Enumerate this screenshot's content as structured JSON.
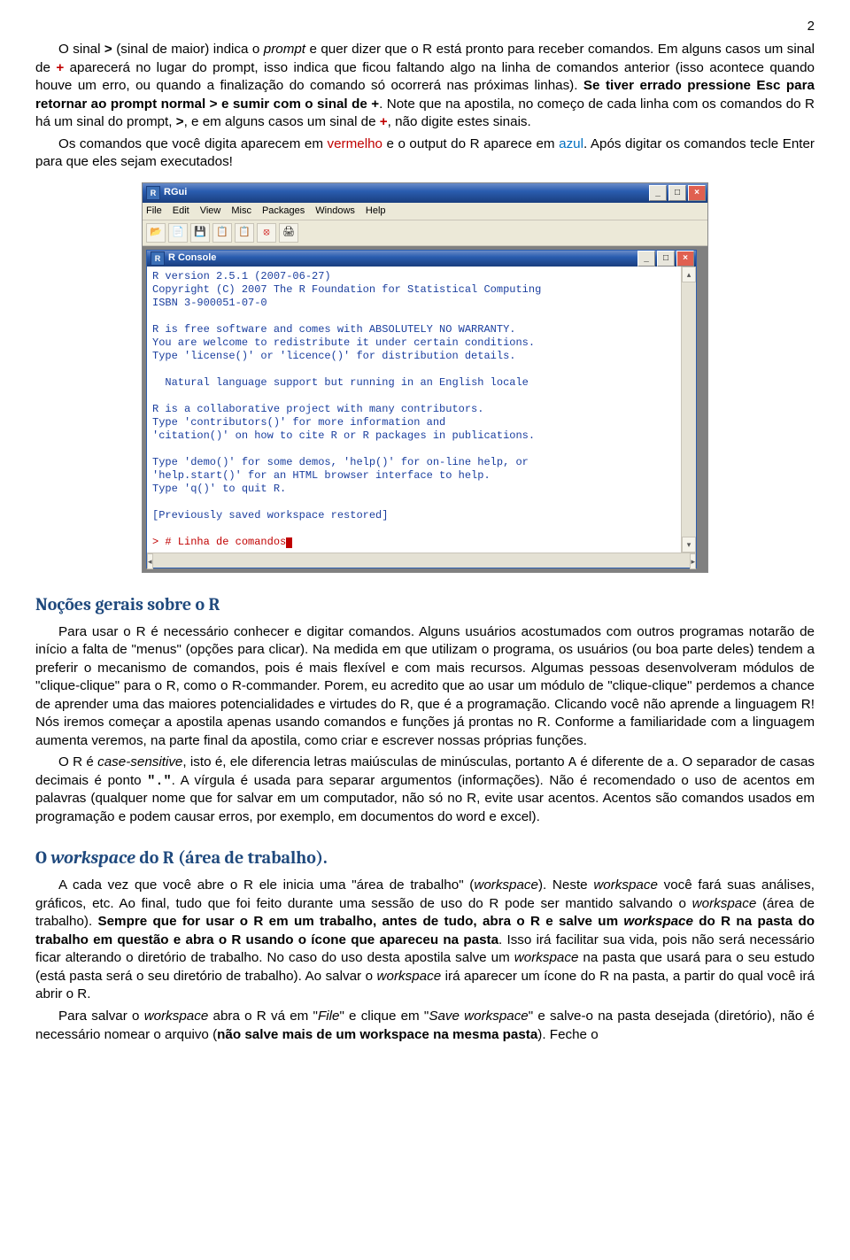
{
  "page_number": "2",
  "para1": {
    "t1": "O sinal ",
    "gt": ">",
    "t2": " (sinal de maior) indica o ",
    "prompt_word": "prompt",
    "t3": " e quer dizer que o R está pronto para receber comandos. Em alguns casos um sinal de ",
    "plus": "+",
    "t4": " aparecerá no lugar do prompt, isso indica que ficou faltando algo na linha de comandos anterior (isso acontece quando houve um erro, ou quando a finalização do comando só ocorrerá nas próximas linhas). ",
    "bold_esc": "Se tiver errado pressione Esc para retornar ao prompt normal > e sumir com o sinal de +",
    "t5": ". Note que na apostila, no começo de cada linha com os comandos do R há um sinal do prompt, ",
    "gt2": ">",
    "t6": ", e em alguns casos um sinal de ",
    "plus2": "+",
    "t7": ", não digite estes sinais."
  },
  "para2": {
    "t1": "Os comandos que você digita aparecem em ",
    "vermelho": "vermelho",
    "t2": " e o output do R aparece em ",
    "azul": "azul",
    "t3": ". Após digitar os comandos tecle Enter para que eles sejam executados!"
  },
  "rgui": {
    "title": "RGui",
    "menus": [
      "File",
      "Edit",
      "View",
      "Misc",
      "Packages",
      "Windows",
      "Help"
    ],
    "console_title": "R Console",
    "lines": {
      "l1": "R version 2.5.1 (2007-06-27)",
      "l2": "Copyright (C) 2007 The R Foundation for Statistical Computing",
      "l3": "ISBN 3-900051-07-0",
      "l5": "R is free software and comes with ABSOLUTELY NO WARRANTY.",
      "l6": "You are welcome to redistribute it under certain conditions.",
      "l7": "Type 'license()' or 'licence()' for distribution details.",
      "l9": "  Natural language support but running in an English locale",
      "l11": "R is a collaborative project with many contributors.",
      "l12": "Type 'contributors()' for more information and",
      "l13": "'citation()' on how to cite R or R packages in publications.",
      "l15": "Type 'demo()' for some demos, 'help()' for on-line help, or",
      "l16": "'help.start()' for an HTML browser interface to help.",
      "l17": "Type 'q()' to quit R.",
      "l19": "[Previously saved workspace restored]",
      "prompt": "> # Linha de comandos"
    }
  },
  "section2_title": "Noções gerais sobre o R",
  "para3": "Para usar o R é necessário conhecer e digitar comandos. Alguns usuários acostumados com outros programas notarão de início a falta de \"menus\" (opções para clicar). Na medida em que utilizam o programa, os usuários (ou boa parte deles) tendem a preferir o mecanismo de comandos, pois é mais flexível e com mais recursos. Algumas pessoas desenvolveram módulos de \"clique-clique\" para o R, como o R-commander. Porem, eu acredito que ao usar um módulo de \"clique-clique\" perdemos a chance de aprender uma das maiores potencialidades e virtudes do R, que é a programação. Clicando você não aprende a linguagem R! Nós iremos começar a apostila apenas usando comandos e funções já prontas no R. Conforme a familiaridade com a linguagem aumenta veremos, na parte final da apostila, como criar e escrever nossas próprias funções.",
  "para4": {
    "t1": "O R é ",
    "cs": "case-sensitive",
    "t2": ", isto é, ele diferencia letras maiúsculas de minúsculas, portanto ",
    "A": "A",
    "t3": " é diferente de ",
    "a": "a",
    "t4": ". O separador de casas decimais é ponto ",
    "dot": "\".\"",
    "t5": ". A vírgula é usada para separar argumentos (informações).  Não é recomendado o uso de acentos em palavras (qualquer nome que for salvar em um computador, não só no R, evite usar acentos. Acentos são comandos usados em programação e podem causar erros, por exemplo, em documentos do word e excel)."
  },
  "section3_title": "O workspace do R (área de trabalho).",
  "para5": {
    "t1": "A cada vez que você abre o R ele inicia uma \"área de trabalho\" (",
    "ws1": "workspace",
    "t2": "). Neste ",
    "ws2": "workspace",
    "t3": " você fará suas análises, gráficos, etc. Ao final, tudo que foi feito durante uma sessão de uso do R pode ser mantido salvando o ",
    "ws3": "workspace",
    "t4": " (área de trabalho). ",
    "bold1": "Sempre que for usar o R em um trabalho, antes de tudo, abra o R e salve um ",
    "ws4": "workspace",
    "bold2": " do R na pasta do trabalho em questão e abra o R usando o ícone que apareceu na pasta",
    "t5": ". Isso irá facilitar sua vida, pois não será necessário ficar alterando o diretório de trabalho. No caso do uso desta apostila salve um ",
    "ws5": "workspace",
    "t6": " na pasta que usará para o seu estudo (está pasta será o seu diretório de trabalho). Ao salvar o ",
    "ws6": "workspace",
    "t7": " irá aparecer um ícone do R na pasta, a partir do qual você irá abrir o R."
  },
  "para6": {
    "t1": "Para salvar o ",
    "ws": "workspace",
    "t2": " abra o R vá em \"",
    "file": "File",
    "t3": "\" e clique em \"",
    "save": "Save workspace",
    "t4": "\" e salve-o na pasta desejada (diretório), não é necessário nomear o arquivo (",
    "bold": "não salve mais de um workspace na mesma pasta",
    "t5": "). Feche o"
  }
}
